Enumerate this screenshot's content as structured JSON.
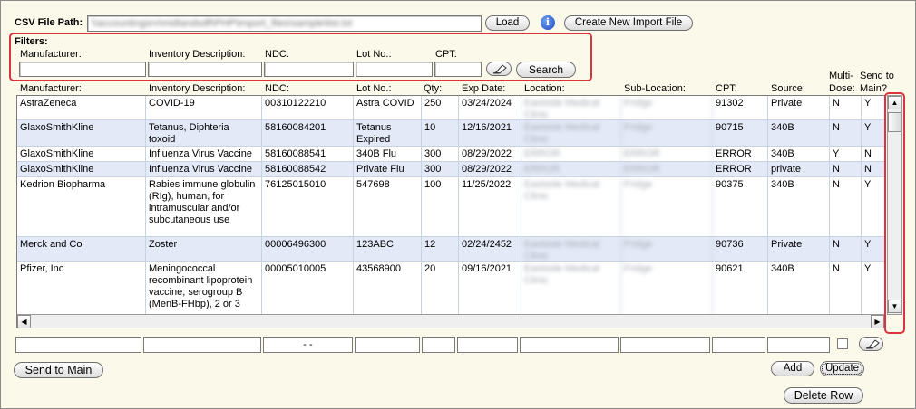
{
  "top": {
    "csv_label": "CSV File Path:",
    "csv_value": "\\\\accountingsrv\\midlandsdfl\\PHP\\import_files\\sample\\list.txt",
    "load_label": "Load",
    "info_icon": "info-icon",
    "create_label": "Create New Import File"
  },
  "filters": {
    "title": "Filters:",
    "manufacturer_label": "Manufacturer:",
    "description_label": "Inventory Description:",
    "ndc_label": "NDC:",
    "lot_label": "Lot No.:",
    "cpt_label": "CPT:",
    "eraser_icon": "eraser-icon",
    "search_label": "Search"
  },
  "columns": {
    "manufacturer": "Manufacturer:",
    "description": "Inventory Description:",
    "ndc": "NDC:",
    "lot": "Lot No.:",
    "qty": "Qty:",
    "exp": "Exp Date:",
    "location": "Location:",
    "sublocation": "Sub-Location:",
    "cpt": "CPT:",
    "source": "Source:",
    "multidose_1": "Multi-",
    "multidose_2": "Dose:",
    "sendmain_1": "Send to",
    "sendmain_2": "Main?"
  },
  "rows": [
    {
      "manufacturer": "AstraZeneca",
      "description": "COVID-19",
      "ndc": "00310122210",
      "lot": "Astra COVID",
      "qty": "250",
      "exp": "03/24/2024",
      "location": "Eastside Medical Clinic",
      "sublocation": "Fridge",
      "cpt": "91302",
      "source": "Private",
      "multidose": "N",
      "sendmain": "Y"
    },
    {
      "manufacturer": "GlaxoSmithKline",
      "description": "Tetanus, Diphteria toxoid",
      "ndc": "58160084201",
      "lot": "Tetanus Expired",
      "qty": "10",
      "exp": "12/16/2021",
      "location": "Eastside Medical Clinic",
      "sublocation": "Fridge",
      "cpt": "90715",
      "source": "340B",
      "multidose": "N",
      "sendmain": "Y"
    },
    {
      "manufacturer": "GlaxoSmithKline",
      "description": "Influenza Virus Vaccine",
      "ndc": "58160088541",
      "lot": "340B Flu",
      "qty": "300",
      "exp": "08/29/2022",
      "location": "ERROR",
      "sublocation": "ERROR",
      "cpt": "ERROR",
      "source": "340B",
      "multidose": "Y",
      "sendmain": "N"
    },
    {
      "manufacturer": "GlaxoSmithKline",
      "description": "Influenza Virus Vaccine",
      "ndc": "58160088542",
      "lot": "Private Flu",
      "qty": "300",
      "exp": "08/29/2022",
      "location": "ERROR",
      "sublocation": "ERROR",
      "cpt": "ERROR",
      "source": "private",
      "multidose": "N",
      "sendmain": "N"
    },
    {
      "manufacturer": "Kedrion Biopharma",
      "description": "Rabies immune globulin (RIg), human, for intramuscular and/or subcutaneous use",
      "ndc": "76125015010",
      "lot": "547698",
      "qty": "100",
      "exp": "11/25/2022",
      "location": "Eastside Medical Clinic",
      "sublocation": "Fridge",
      "cpt": "90375",
      "source": "340B",
      "multidose": "N",
      "sendmain": "Y"
    },
    {
      "manufacturer": "Merck and Co",
      "description": "Zoster",
      "ndc": "00006496300",
      "lot": "123ABC",
      "qty": "12",
      "exp": "02/24/2452",
      "location": "Eastside Medical Clinic",
      "sublocation": "Fridge",
      "cpt": "90736",
      "source": "Private",
      "multidose": "N",
      "sendmain": "Y"
    },
    {
      "manufacturer": "Pfizer, Inc",
      "description": "Meningococcal recombinant lipoprotein vaccine, serogroup B (MenB-FHbp), 2 or 3",
      "ndc": "00005010005",
      "lot": "43568900",
      "qty": "20",
      "exp": "09/16/2021",
      "location": "Eastside Medical Clinic",
      "sublocation": "Fridge",
      "cpt": "90621",
      "source": "340B",
      "multidose": "N",
      "sendmain": "Y"
    }
  ],
  "editor": {
    "ndc_mask": "-   -",
    "eraser_icon": "eraser-icon"
  },
  "actions": {
    "send_to_main": "Send to Main",
    "add": "Add",
    "update": "Update",
    "delete_row": "Delete Row"
  },
  "colors": {
    "window_bg": "#fbf9ea",
    "row_alt": "#e3e9f7",
    "highlight": "#d9343f",
    "info": "#1f4fbf"
  }
}
